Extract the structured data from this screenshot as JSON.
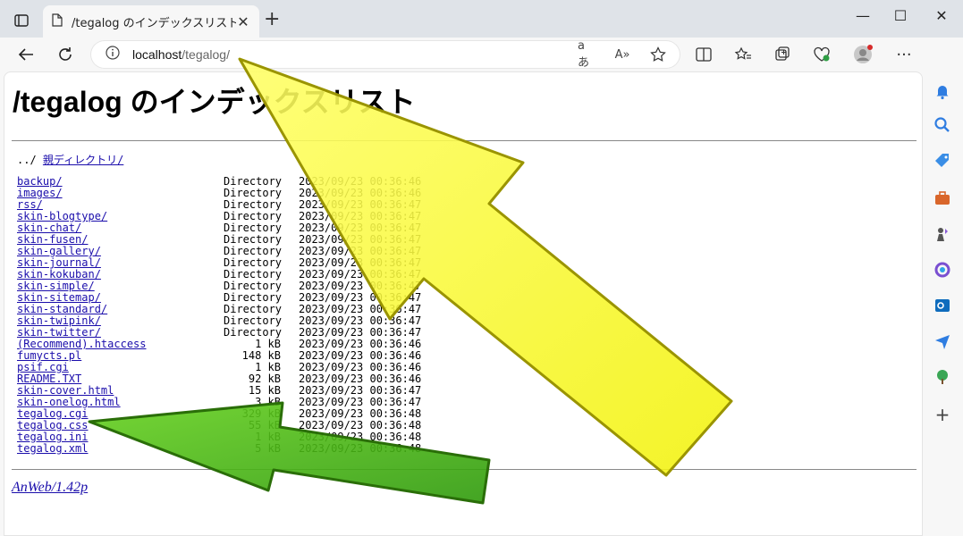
{
  "browser": {
    "tab_title": "/tegalog のインデックスリスト",
    "address_host": "localhost",
    "address_path": "/tegalog/",
    "window_controls": [
      "minimize",
      "maximize",
      "close"
    ]
  },
  "page": {
    "heading": "/tegalog のインデックスリスト",
    "parent_prefix": "../",
    "parent_link": "親ディレクトリ/",
    "footer": "AnWeb/1.42p",
    "entries": [
      {
        "name": "backup/",
        "type": "Directory",
        "date": "2023/09/23 00:36:46"
      },
      {
        "name": "images/",
        "type": "Directory",
        "date": "2023/09/23 00:36:46"
      },
      {
        "name": "rss/",
        "type": "Directory",
        "date": "2023/09/23 00:36:47"
      },
      {
        "name": "skin-blogtype/",
        "type": "Directory",
        "date": "2023/09/23 00:36:47"
      },
      {
        "name": "skin-chat/",
        "type": "Directory",
        "date": "2023/09/23 00:36:47"
      },
      {
        "name": "skin-fusen/",
        "type": "Directory",
        "date": "2023/09/23 00:36:47"
      },
      {
        "name": "skin-gallery/",
        "type": "Directory",
        "date": "2023/09/23 00:36:47"
      },
      {
        "name": "skin-journal/",
        "type": "Directory",
        "date": "2023/09/23 00:36:47"
      },
      {
        "name": "skin-kokuban/",
        "type": "Directory",
        "date": "2023/09/23 00:36:47"
      },
      {
        "name": "skin-simple/",
        "type": "Directory",
        "date": "2023/09/23 00:36:47"
      },
      {
        "name": "skin-sitemap/",
        "type": "Directory",
        "date": "2023/09/23 00:36:47"
      },
      {
        "name": "skin-standard/",
        "type": "Directory",
        "date": "2023/09/23 00:36:47"
      },
      {
        "name": "skin-twipink/",
        "type": "Directory",
        "date": "2023/09/23 00:36:47"
      },
      {
        "name": "skin-twitter/",
        "type": "Directory",
        "date": "2023/09/23 00:36:47"
      },
      {
        "name": "(Recommend).htaccess",
        "size": "1 kB",
        "date": "2023/09/23 00:36:46"
      },
      {
        "name": "fumycts.pl",
        "size": "148 kB",
        "date": "2023/09/23 00:36:46"
      },
      {
        "name": "psif.cgi",
        "size": "1 kB",
        "date": "2023/09/23 00:36:46"
      },
      {
        "name": "README.TXT",
        "size": "92 kB",
        "date": "2023/09/23 00:36:46"
      },
      {
        "name": "skin-cover.html",
        "size": "15 kB",
        "date": "2023/09/23 00:36:47"
      },
      {
        "name": "skin-onelog.html",
        "size": "3 kB",
        "date": "2023/09/23 00:36:47"
      },
      {
        "name": "tegalog.cgi",
        "size": "329 kB",
        "date": "2023/09/23 00:36:48"
      },
      {
        "name": "tegalog.css",
        "size": "55 kB",
        "date": "2023/09/23 00:36:48"
      },
      {
        "name": "tegalog.ini",
        "size": "1 kB",
        "date": "2023/09/23 00:36:48"
      },
      {
        "name": "tegalog.xml",
        "size": "5 kB",
        "date": "2023/09/23 00:36:48"
      }
    ]
  },
  "colors": {
    "link": "#1a0dab",
    "yellow_arrow": "#ffff33",
    "green_arrow": "#44bb11"
  }
}
